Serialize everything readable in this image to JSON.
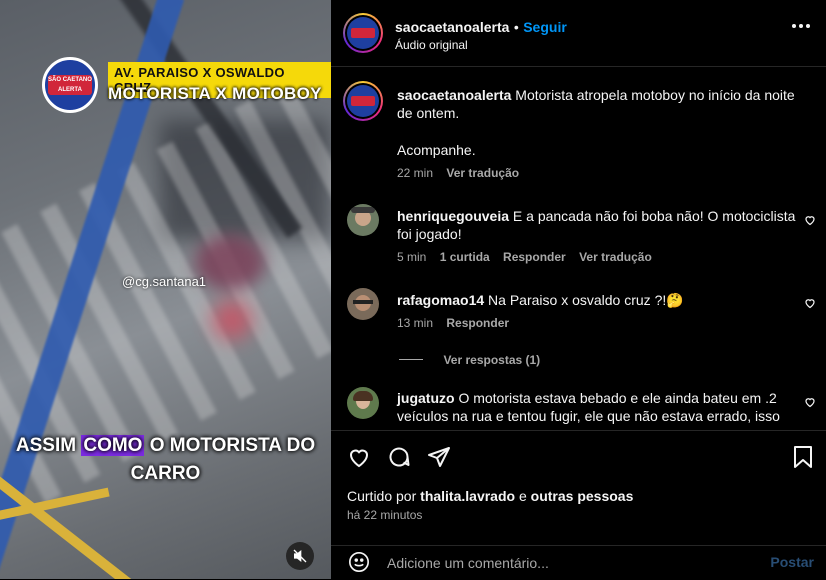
{
  "video": {
    "tag_top": "AV. PARAISO X OSWALDO CRUZ",
    "tag_title": "MOTORISTA X MOTOBOY",
    "logo_text_1": "SÃO CAETANO",
    "logo_text_2": "ALERTA",
    "credit": "@cg.santana1",
    "caption_before": "ASSIM ",
    "caption_highlight": "COMO",
    "caption_after": " O MOTORISTA DO",
    "caption_line2": "CARRO",
    "mute_icon": "muted-speaker-icon"
  },
  "header": {
    "username": "saocaetanoalerta",
    "separator": "•",
    "follow_label": "Seguir",
    "audio": "Áudio original"
  },
  "post": {
    "username": "saocaetanoalerta",
    "text": "Motorista atropela motoboy no início da noite de ontem.",
    "text2": "Acompanhe.",
    "time": "22 min",
    "translate": "Ver tradução"
  },
  "comments": [
    {
      "username": "henriquegouveia",
      "text": "E a pancada não foi boba não! O motociclista foi jogado!",
      "time": "5 min",
      "likes": "1 curtida",
      "reply": "Responder",
      "translate": "Ver tradução"
    },
    {
      "username": "rafagomao14",
      "text": "Na Paraiso x osvaldo cruz ?!🤔",
      "time": "13 min",
      "reply": "Responder",
      "view_replies": "Ver respostas (1)"
    },
    {
      "username": "jugatuzo",
      "text": "O motorista estava bebado e ele ainda bateu em .2 veículos na rua e tentou fugir, ele que não estava errado, isso"
    }
  ],
  "actions": {
    "liked_by_prefix": "Curtido por ",
    "liked_by_user": "thalita.lavrado",
    "liked_by_mid": " e ",
    "liked_by_others": "outras pessoas",
    "timestamp": "há 22 minutos"
  },
  "composer": {
    "placeholder": "Adicione um comentário...",
    "post_label": "Postar"
  },
  "colors": {
    "accent": "#0095f6",
    "highlight": "#7b2be0",
    "tag_yellow": "#f5d90a"
  }
}
